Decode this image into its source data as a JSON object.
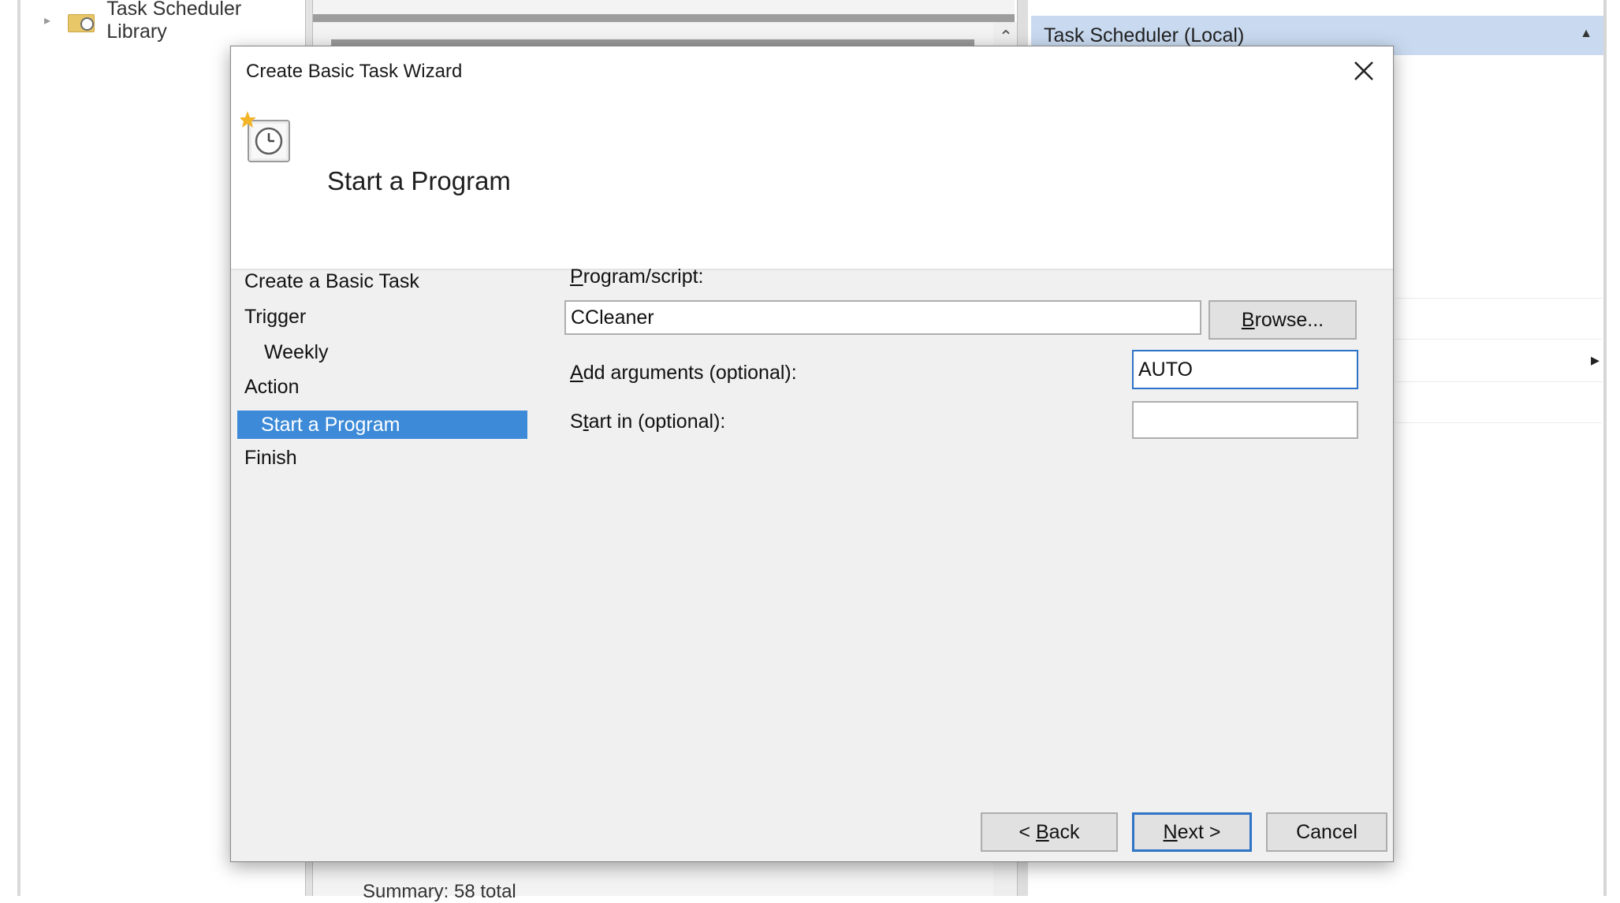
{
  "background": {
    "tree": {
      "library_label": "Task Scheduler Library"
    },
    "actions_panel": {
      "header": "Task Scheduler (Local)"
    },
    "summary_text": "Summary: 58 total"
  },
  "dialog": {
    "title": "Create Basic Task Wizard",
    "header_title": "Start a Program",
    "steps": [
      {
        "label": "Create a Basic Task"
      },
      {
        "label": "Trigger"
      },
      {
        "label": "Weekly"
      },
      {
        "label": "Action"
      },
      {
        "label": "Start a Program",
        "selected": true
      },
      {
        "label": "Finish"
      }
    ],
    "form": {
      "program_label_key": "P",
      "program_label_rest": "rogram/script:",
      "program_value": "CCleaner",
      "browse_key": "B",
      "browse_rest": "rowse...",
      "args_label_key": "A",
      "args_label_rest": "dd arguments (optional):",
      "args_value": "AUTO",
      "start_in_label_pre": "S",
      "start_in_label_key": "t",
      "start_in_label_rest": "art in (optional):",
      "start_in_value": ""
    },
    "buttons": {
      "back_pre": "< ",
      "back_key": "B",
      "back_rest": "ack",
      "next_key": "N",
      "next_rest": "ext >",
      "cancel": "Cancel"
    }
  }
}
